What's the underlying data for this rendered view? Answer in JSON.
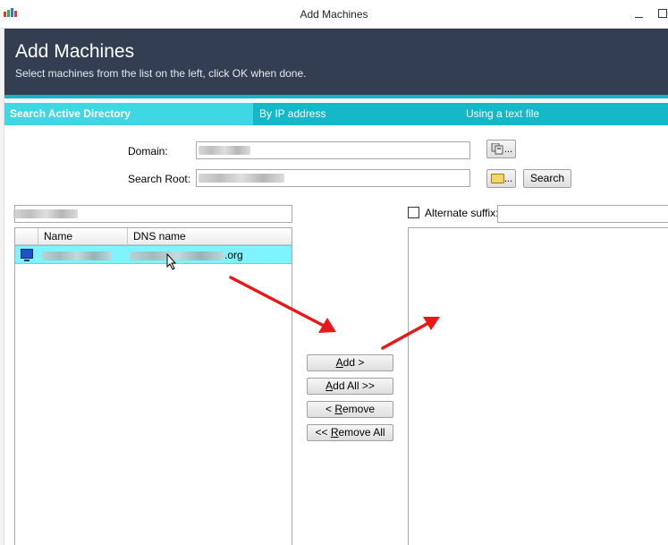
{
  "window": {
    "title": "Add Machines",
    "app_icon": "app-bars-icon",
    "controls": [
      "minimize-icon",
      "maximize-icon"
    ]
  },
  "header": {
    "title": "Add Machines",
    "subtitle": "Select machines from the list on the left, click OK when done."
  },
  "tabs": [
    {
      "label": "Search Active Directory",
      "active": true
    },
    {
      "label": "By IP address",
      "active": false
    },
    {
      "label": "Using a text file",
      "active": false
    }
  ],
  "form": {
    "domain_label": "Domain:",
    "search_root_label": "Search Root:",
    "browse_label": "...",
    "search_button": "Search"
  },
  "left_list": {
    "columns": [
      "Name",
      "DNS name"
    ],
    "rows": [
      {
        "dns_suffix": ".org",
        "selected": true
      }
    ]
  },
  "buttons": {
    "add": {
      "mnemonic": "A",
      "rest": "dd >"
    },
    "add_all": {
      "mnemonic": "A",
      "rest": "dd All >>"
    },
    "remove": {
      "pre": "< ",
      "mnemonic": "R",
      "rest": "emove"
    },
    "remove_all": {
      "pre": "<< ",
      "mnemonic": "R",
      "rest": "emove All"
    }
  },
  "right_panel": {
    "alternate_suffix_label": "Alternate suffix:",
    "alternate_suffix_checked": false
  },
  "colors": {
    "header_bg": "#333e52",
    "tab_bar": "#14b8c8",
    "tab_active": "#40d7e4",
    "row_highlight": "#7ff3ff",
    "annotation_arrow": "#e81818"
  }
}
